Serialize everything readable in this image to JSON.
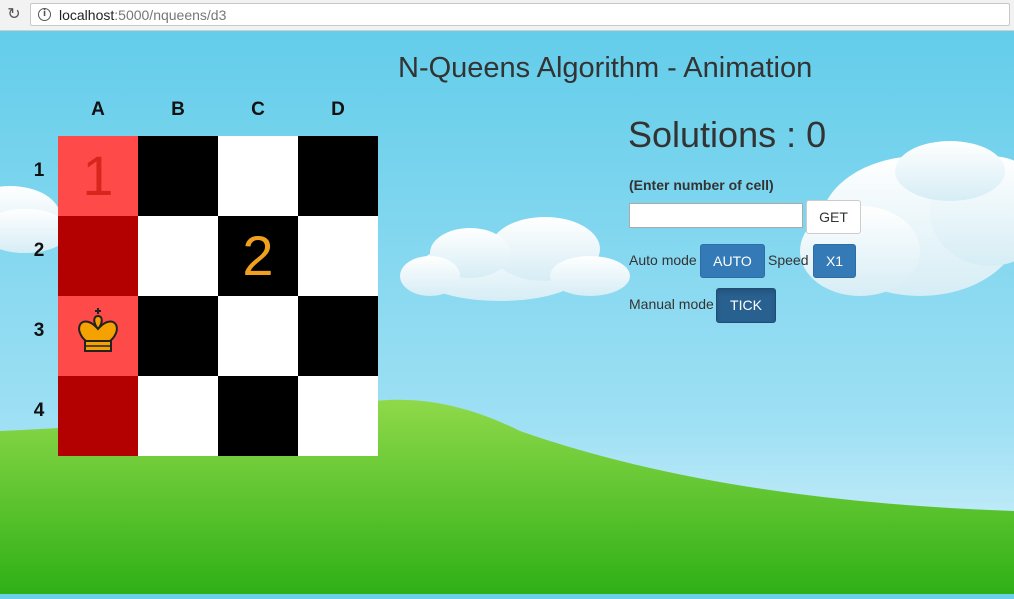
{
  "browser": {
    "url_host": "localhost",
    "url_path": ":5000/nqueens/d3",
    "reload_icon": "reload-icon",
    "info_icon": "info-icon"
  },
  "page": {
    "title": "N-Queens Algorithm - Animation"
  },
  "board": {
    "columns": [
      "A",
      "B",
      "C",
      "D"
    ],
    "rows": [
      "1",
      "2",
      "3",
      "4"
    ],
    "cell_markers": [
      {
        "col": 0,
        "row": 0,
        "text": "1",
        "color": "#d9261c"
      },
      {
        "col": 2,
        "row": 1,
        "text": "2",
        "color": "#f0a01c"
      }
    ],
    "queen": {
      "col": 0,
      "row": 2,
      "icon": "queen-icon"
    },
    "colors": {
      "highlight_light": "#ff4a4a",
      "highlight_dark": "#b30000",
      "dark": "#000000",
      "light": "#ffffff",
      "queen": "#f5a100"
    }
  },
  "controls": {
    "solutions_text": "Solutions : 0",
    "cell_prompt": "(Enter number of cell)",
    "cell_input_value": "",
    "get_label": "GET",
    "auto_mode_label": "Auto mode",
    "auto_button": "AUTO",
    "speed_label": "Speed",
    "speed_button": "X1",
    "manual_mode_label": "Manual mode",
    "tick_button": "TICK"
  },
  "theme": {
    "accent": "#337ab7",
    "sky": "#6ad0ec",
    "grass": "#5bc42a"
  }
}
